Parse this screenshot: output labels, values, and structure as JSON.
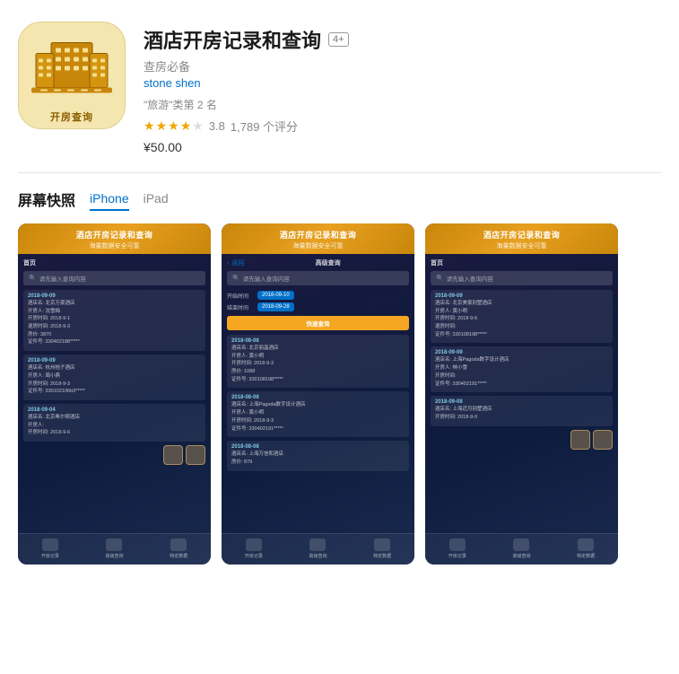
{
  "app": {
    "title": "酒店开房记录和查询",
    "age_rating": "4+",
    "subtitle": "查房必备",
    "developer": "stone shen",
    "category": "\"旅游\"类第 2 名",
    "rating_value": "3.8",
    "rating_count": "1,789 个评分",
    "price": "¥50.00",
    "icon_label": "开房查询"
  },
  "screenshots": {
    "label": "屏幕快照",
    "tabs": [
      {
        "id": "iphone",
        "label": "iPhone",
        "active": true
      },
      {
        "id": "ipad",
        "label": "iPad",
        "active": false
      }
    ],
    "header_title": "酒店开房记录和查询",
    "header_sub": "海量数据安全可靠",
    "screens": [
      {
        "id": "screen1",
        "type": "home",
        "search_placeholder": "请先输入查询内容",
        "records": [
          {
            "date": "2018-09-09",
            "lines": [
              "酒店名: 北京万豪酒店",
              "开房人: 沈雪梅",
              "开房时间: 2018-9-1",
              "退房时间: 2018-9-3",
              "房价: 3870",
              "证件号: 330402188*****"
            ]
          },
          {
            "date": "2018-09-09",
            "lines": [
              "酒店名: 杭州桔子酒店",
              "开房人: 周小燕",
              "开房时间: 2018-9-3",
              "证件号: 330102106b3*****"
            ]
          },
          {
            "date": "2018-09-04",
            "lines": [
              "酒店名: 北京希尔顿酒店",
              "开房人:",
              "开房时间: 2018-9-6"
            ]
          }
        ],
        "bottom_tabs": [
          "开房记录",
          "高级查询",
          "特定数据"
        ]
      },
      {
        "id": "screen2",
        "type": "advanced",
        "back_label": "返回",
        "section_title": "高级查询",
        "start_label": "开始时间",
        "start_value": "2018-09-10",
        "end_label": "结束时间",
        "end_value": "2018-09-28",
        "search_btn": "快速查询",
        "records": [
          {
            "date": "2018-08-08",
            "lines": [
              "酒店名: 北京丽晶酒店",
              "开房人: 黄小明",
              "开房时间: 2018-9-3",
              "退房时间:",
              "房价: 1088",
              "证件号: 330108198*****"
            ]
          },
          {
            "date": "2018-08-08",
            "lines": [
              "酒店名: 上海Pagoda数字设计酒店",
              "开房人: 黄小明",
              "开房时间: 2018-9-3",
              "证件号: 330402191*****"
            ]
          },
          {
            "date": "2018-08-08",
            "lines": [
              "酒店名: 上海万信和酒店",
              "房价: 879"
            ]
          }
        ],
        "bottom_tabs": [
          "开房记录",
          "高级查询",
          "特定数据"
        ]
      },
      {
        "id": "screen3",
        "type": "home2",
        "search_placeholder": "请先输入查询内容",
        "records": [
          {
            "date": "2018-09-09",
            "lines": [
              "酒店名: 北京美豪别墅酒店",
              "开房人: 黄小明",
              "开房时间: 2018-9-6",
              "退房时间:",
              "证件号: 330108198*****"
            ]
          },
          {
            "date": "2018-09-09",
            "lines": [
              "酒店名: 上海Pagoda数字设计酒店",
              "开房人: 林小雪",
              "开房时间:",
              "证件号: 330402191*****"
            ]
          },
          {
            "date": "2018-09-08",
            "lines": [
              "酒店名: 上海近月别墅酒店",
              "开房时间: 2018-9-0"
            ]
          }
        ],
        "bottom_tabs": [
          "开房记录",
          "高级查询",
          "特定数据"
        ]
      }
    ]
  },
  "colors": {
    "accent": "#0070c9",
    "star": "#f0a500",
    "bg": "#ffffff",
    "price": "#1a1a1a",
    "developer": "#0070c9"
  }
}
